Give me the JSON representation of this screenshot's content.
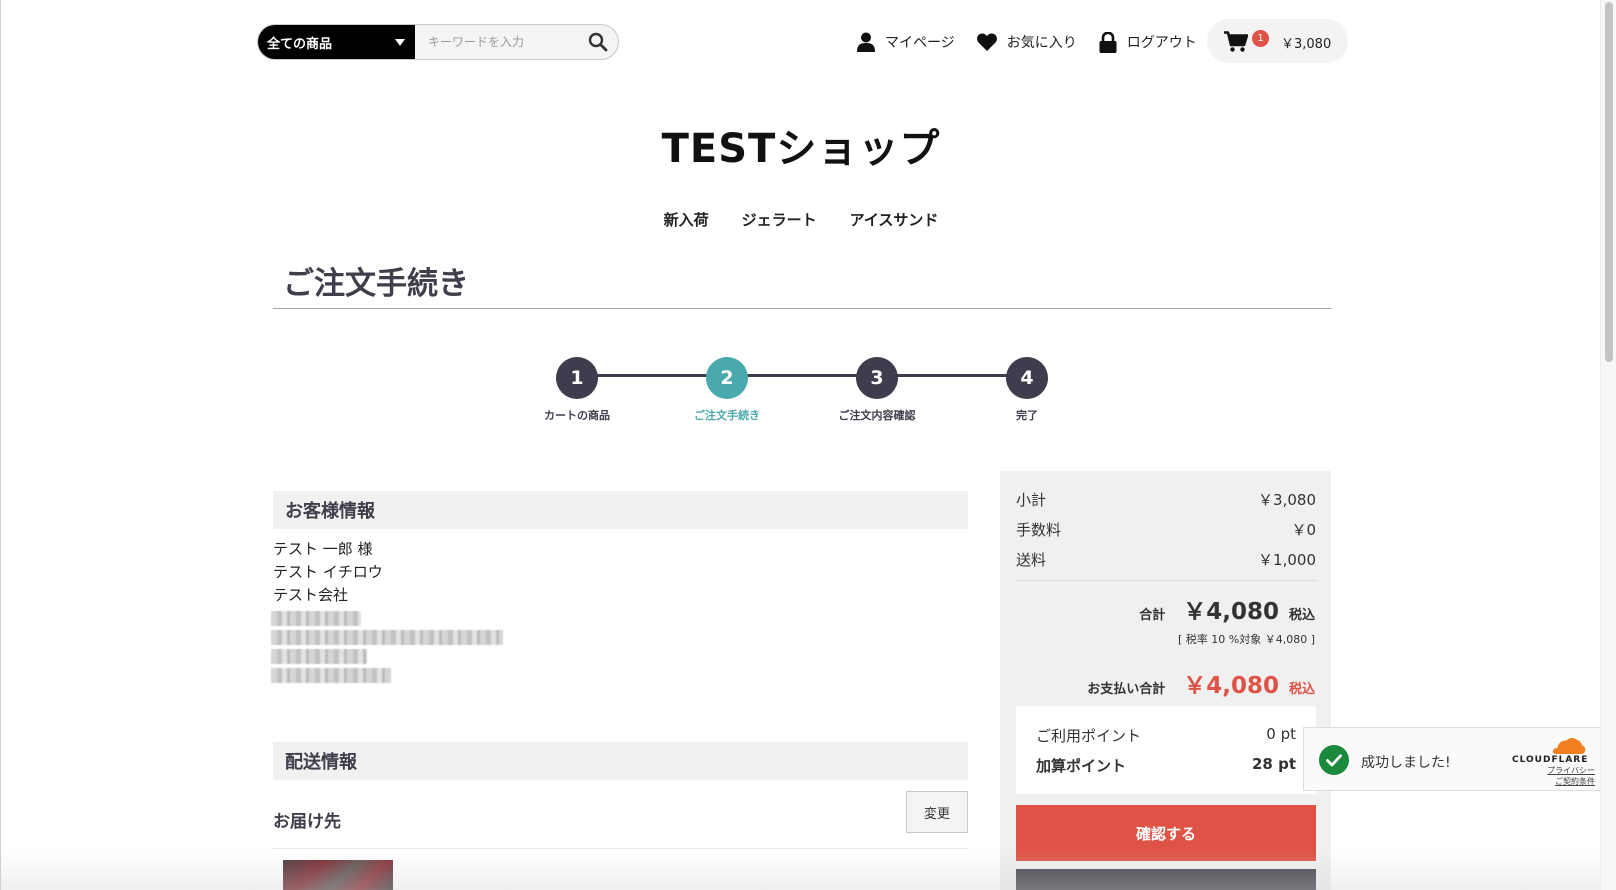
{
  "header": {
    "category_select": "全ての商品",
    "search_placeholder": "キーワードを入力",
    "mypage": "マイページ",
    "favorites": "お気に入り",
    "logout": "ログアウト",
    "cart_count": "1",
    "cart_total": "￥3,080"
  },
  "shop_title": "TESTショップ",
  "category_nav": [
    "新入荷",
    "ジェラート",
    "アイスサンド"
  ],
  "page_heading": "ご注文手続き",
  "steps": [
    {
      "number": "1",
      "label": "カートの商品"
    },
    {
      "number": "2",
      "label": "ご注文手続き"
    },
    {
      "number": "3",
      "label": "ご注文内容確認"
    },
    {
      "number": "4",
      "label": "完了"
    }
  ],
  "customer": {
    "heading": "お客様情報",
    "lines": [
      "テスト 一郎 様",
      "テスト イチロウ",
      "テスト会社"
    ]
  },
  "shipping": {
    "heading": "配送情報",
    "destination_label": "お届け先",
    "change_label": "変更"
  },
  "summary": {
    "subtotal_label": "小計",
    "subtotal": "￥3,080",
    "fee_label": "手数料",
    "fee": "￥0",
    "shipping_label": "送料",
    "shipping": "￥1,000",
    "total_label": "合計",
    "total": "￥4,080",
    "tax_included": "税込",
    "tax_note": "[ 税率 10 %対象  ￥4,080 ]",
    "payment_label": "お支払い合計",
    "payment_total": "￥4,080",
    "used_points_label": "ご利用ポイント",
    "used_points": "0 pt",
    "added_points_label": "加算ポイント",
    "added_points": "28 pt",
    "confirm_label": "確認する"
  },
  "cloudflare": {
    "message": "成功しました!",
    "brand": "CLOUDFLARE",
    "privacy": "プライバシー",
    "terms": "ご契約条件"
  },
  "colors": {
    "accent_red": "#de5346",
    "active_step": "#4aa9ac",
    "step_dark": "#3d3d4d",
    "success_green": "#1b8a3d"
  }
}
